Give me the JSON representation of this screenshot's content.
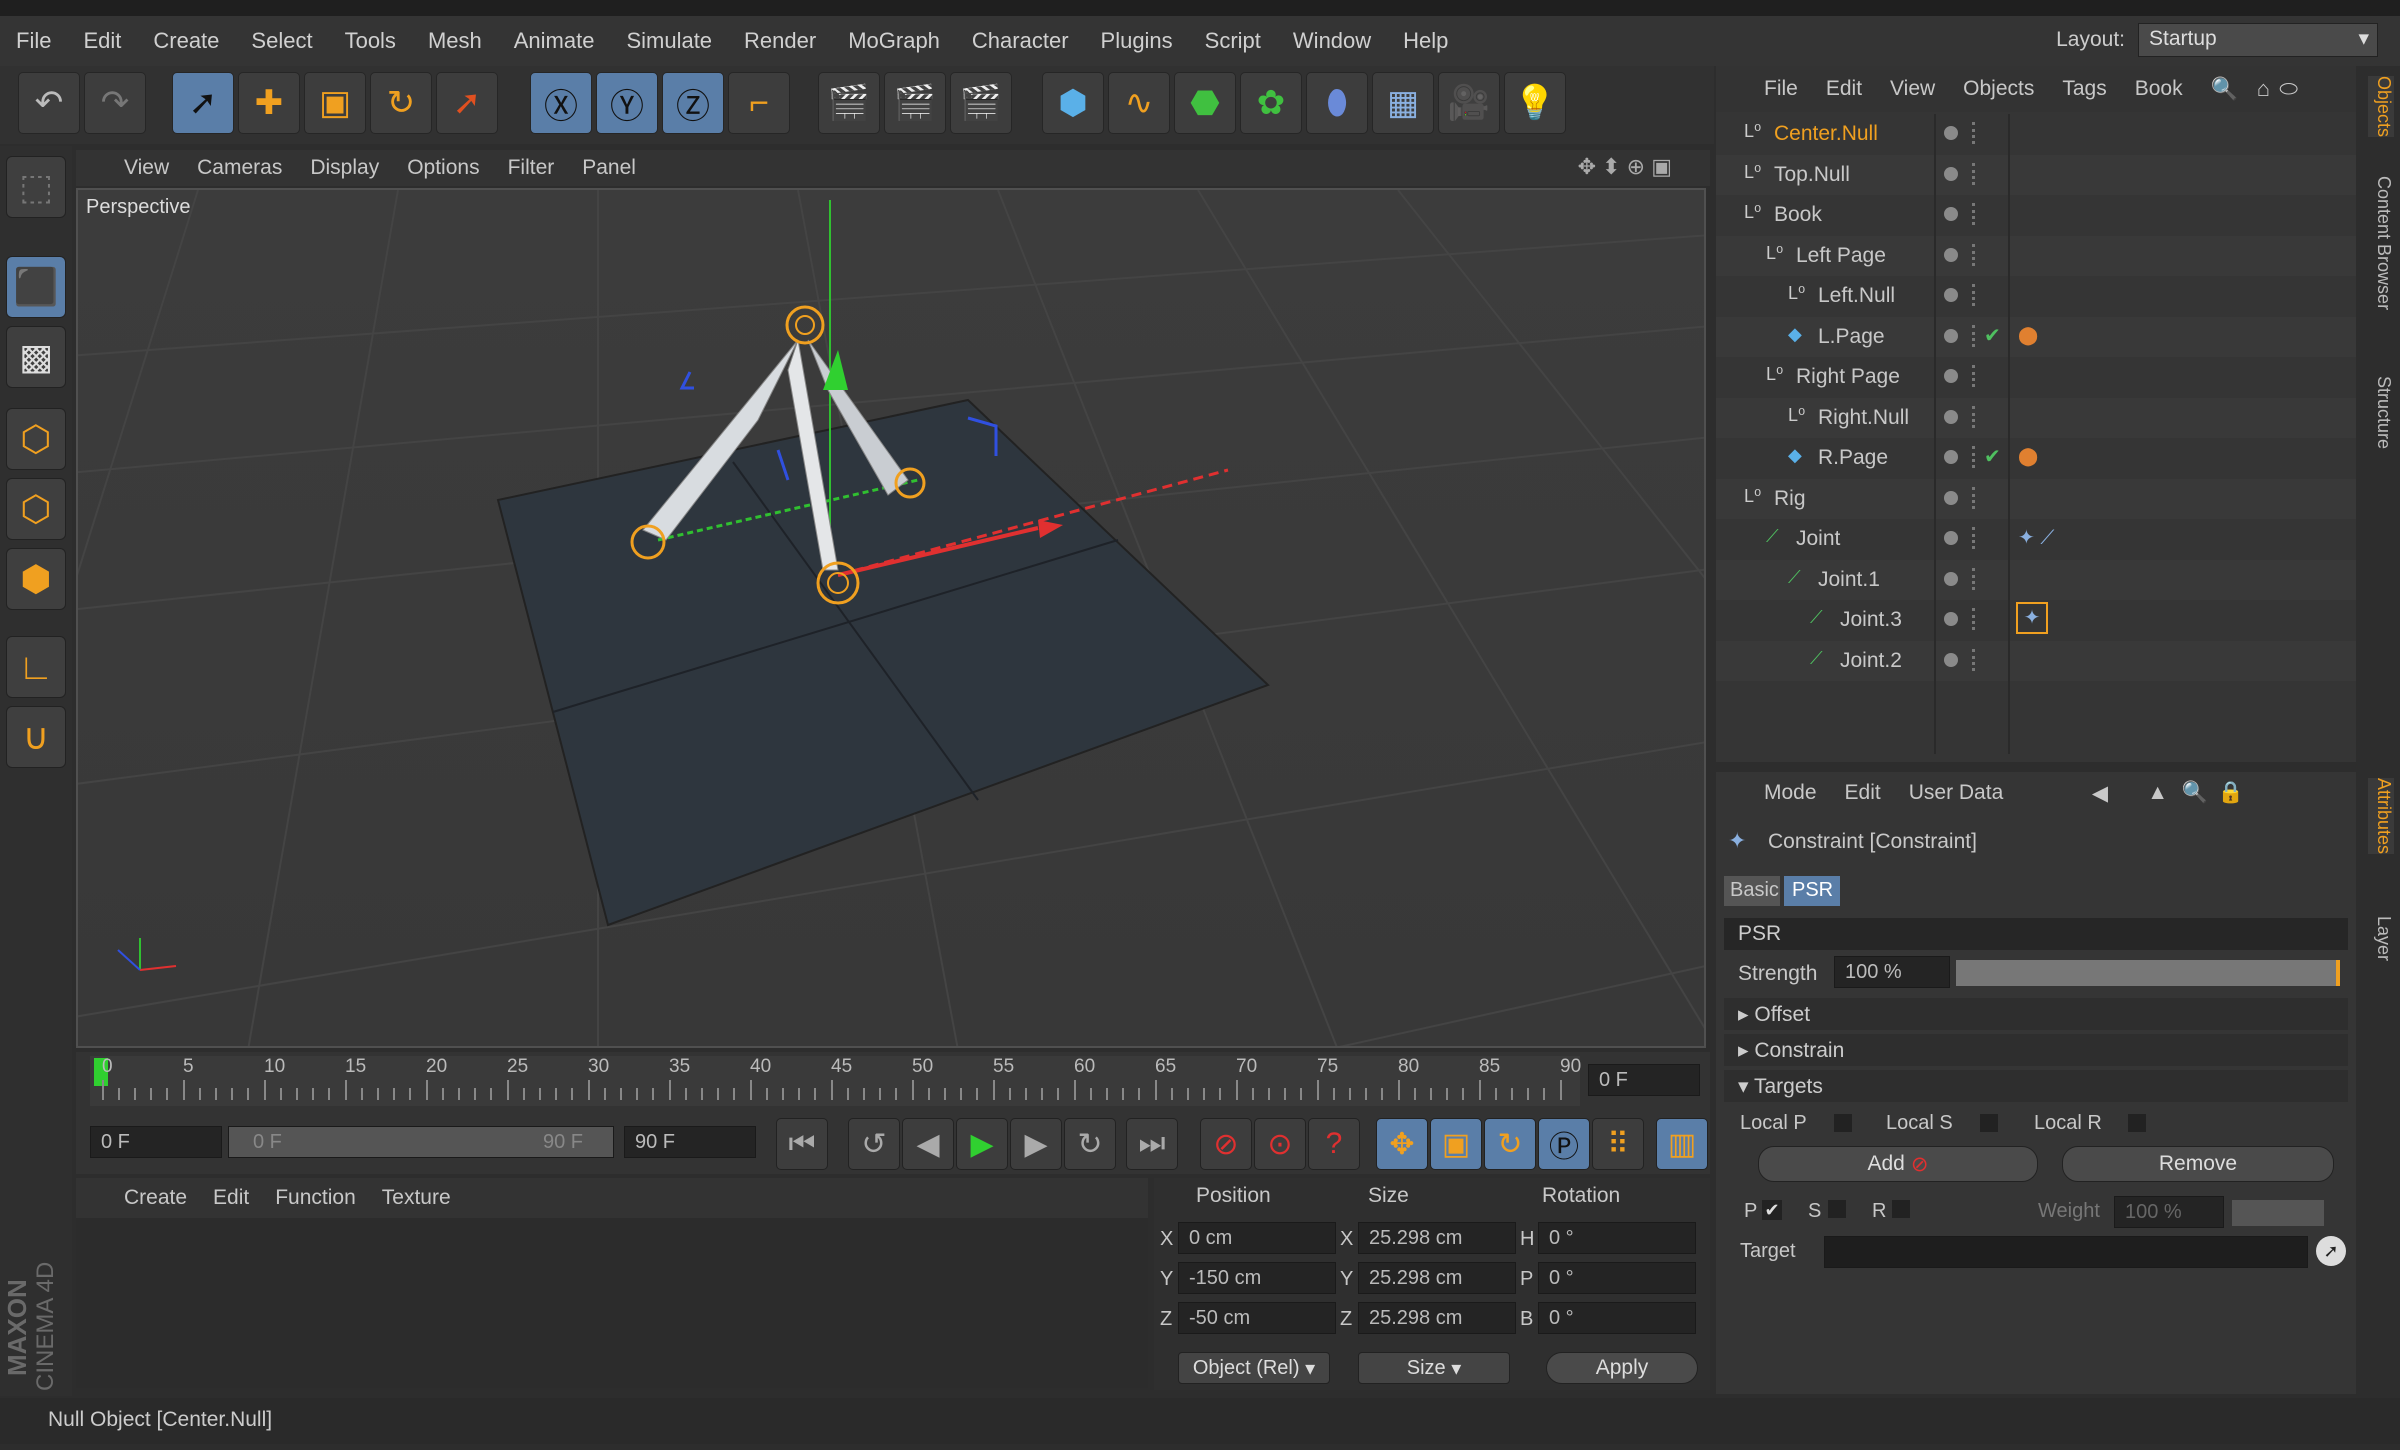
{
  "menu": [
    "File",
    "Edit",
    "Create",
    "Select",
    "Tools",
    "Mesh",
    "Animate",
    "Simulate",
    "Render",
    "MoGraph",
    "Character",
    "Plugins",
    "Script",
    "Window",
    "Help"
  ],
  "layout": {
    "label": "Layout:",
    "value": "Startup"
  },
  "viewport": {
    "menu": [
      "View",
      "Cameras",
      "Display",
      "Options",
      "Filter",
      "Panel"
    ],
    "label": "Perspective"
  },
  "timeline": {
    "ticks": [
      "0",
      "5",
      "10",
      "15",
      "20",
      "25",
      "30",
      "35",
      "40",
      "45",
      "50",
      "55",
      "60",
      "65",
      "70",
      "75",
      "80",
      "85",
      "90"
    ],
    "current_frame": "0 F",
    "start": "0 F",
    "range_start": "0 F",
    "range_end": "90 F",
    "end": "90 F"
  },
  "material": {
    "menu": [
      "Create",
      "Edit",
      "Function",
      "Texture"
    ]
  },
  "coords": {
    "headers": [
      "Position",
      "Size",
      "Rotation"
    ],
    "rows": [
      {
        "axis": "X",
        "pos": "0 cm",
        "saxis": "X",
        "size": "25.298 cm",
        "raxis": "H",
        "rot": "0 °"
      },
      {
        "axis": "Y",
        "pos": "-150 cm",
        "saxis": "Y",
        "size": "25.298 cm",
        "raxis": "P",
        "rot": "0 °"
      },
      {
        "axis": "Z",
        "pos": "-50 cm",
        "saxis": "Z",
        "size": "25.298 cm",
        "raxis": "B",
        "rot": "0 °"
      }
    ],
    "mode": "Object (Rel)",
    "size_mode": "Size",
    "apply": "Apply"
  },
  "status": "Null Object [Center.Null]",
  "branding": {
    "maxon": "MAXON",
    "product": "CINEMA 4D"
  },
  "objects": {
    "menu": [
      "File",
      "Edit",
      "View",
      "Objects",
      "Tags",
      "Book"
    ],
    "items": [
      {
        "name": "Center.Null",
        "depth": 0,
        "selected": true
      },
      {
        "name": "Top.Null",
        "depth": 0
      },
      {
        "name": "Book",
        "depth": 0
      },
      {
        "name": "Left Page",
        "depth": 1
      },
      {
        "name": "Left.Null",
        "depth": 2
      },
      {
        "name": "L.Page",
        "depth": 2
      },
      {
        "name": "Right Page",
        "depth": 1
      },
      {
        "name": "Right.Null",
        "depth": 2
      },
      {
        "name": "R.Page",
        "depth": 2
      },
      {
        "name": "Rig",
        "depth": 0
      },
      {
        "name": "Joint",
        "depth": 1
      },
      {
        "name": "Joint.1",
        "depth": 2
      },
      {
        "name": "Joint.3",
        "depth": 3
      },
      {
        "name": "Joint.2",
        "depth": 3
      }
    ]
  },
  "attributes": {
    "menu": [
      "Mode",
      "Edit",
      "User Data"
    ],
    "title": "Constraint [Constraint]",
    "tabs": [
      "Basic",
      "PSR"
    ],
    "section": "PSR",
    "strength_label": "Strength",
    "strength_value": "100 %",
    "groups": [
      "Offset",
      "Constrain",
      "Targets"
    ],
    "local": [
      "Local P",
      "Local S",
      "Local R"
    ],
    "add": "Add",
    "remove": "Remove",
    "psr": [
      "P",
      "S",
      "R"
    ],
    "weight_label": "Weight",
    "weight_value": "100 %",
    "target_label": "Target"
  },
  "side_tabs": [
    "Objects",
    "Content Browser",
    "Structure",
    "Attributes",
    "Layer"
  ],
  "colors": {
    "accent_orange": "#f0a020",
    "selection_blue": "#5a7ea8",
    "axis_red": "#e03030",
    "axis_green": "#30c030",
    "axis_blue": "#3050e0"
  }
}
